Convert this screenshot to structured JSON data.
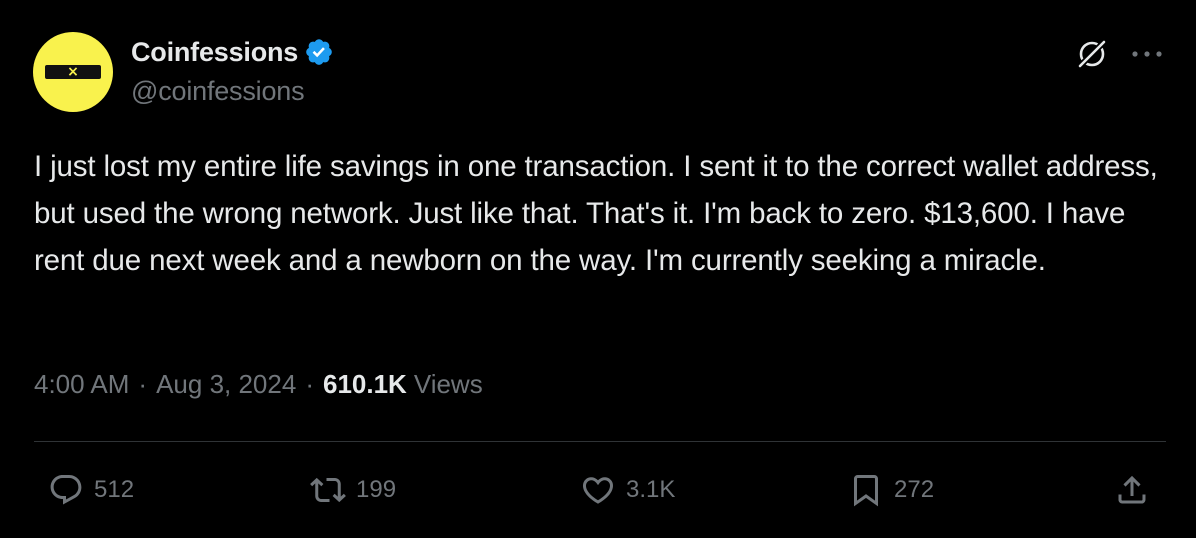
{
  "author": {
    "display_name": "Coinfessions",
    "handle": "@coinfessions",
    "verified": true,
    "avatar_glyph": "×"
  },
  "tweet": {
    "text": "I just lost my entire life savings in one transaction. I sent it to the correct wallet address, but used the wrong network. Just like that. That's it. I'm back to zero. $13,600. I have rent due next week and a newborn on the way. I'm currently seeking a miracle.",
    "time": "4:00 AM",
    "date": "Aug 3, 2024",
    "separator": "·",
    "views_count": "610.1K",
    "views_label": "Views"
  },
  "actions": {
    "replies": "512",
    "retweets": "199",
    "likes": "3.1K",
    "bookmarks": "272"
  },
  "icons": {
    "top_right": [
      "grok-icon",
      "more-icon"
    ],
    "actions": [
      "reply-icon",
      "retweet-icon",
      "like-icon",
      "bookmark-icon",
      "share-icon"
    ]
  },
  "colors": {
    "background": "#000000",
    "primary_text": "#e7e9ea",
    "secondary_text": "#71767b",
    "verified_blue": "#1d9bf0",
    "avatar_yellow": "#f9f24d",
    "divider": "#2f3336"
  }
}
